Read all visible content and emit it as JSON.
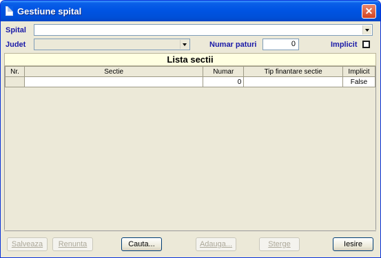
{
  "window": {
    "title": "Gestiune spital",
    "close_symbol": "✕"
  },
  "form": {
    "spital_label": "Spital",
    "spital_value": "",
    "judet_label": "Judet",
    "judet_value": "",
    "numar_paturi_label": "Numar paturi",
    "numar_paturi_value": "0",
    "implicit_label": "Implicit",
    "implicit_checked": false
  },
  "list": {
    "title": "Lista sectii",
    "columns": [
      "Nr.",
      "Sectie",
      "Numar",
      "Tip finantare sectie",
      "Implicit"
    ],
    "rows": [
      {
        "nr": "",
        "sectie": "",
        "numar": "0",
        "tip": "",
        "implicit": "False"
      }
    ]
  },
  "buttons": {
    "salveaza": "Salveaza",
    "renunta": "Renunta",
    "cauta": "Cauta...",
    "adauga": "Adauga...",
    "sterge": "Sterge",
    "iesire": "Iesire"
  },
  "colors": {
    "title_bar": "#0054e3",
    "label_blue": "#1a1aa8",
    "header_yellow": "#ffffe1"
  }
}
